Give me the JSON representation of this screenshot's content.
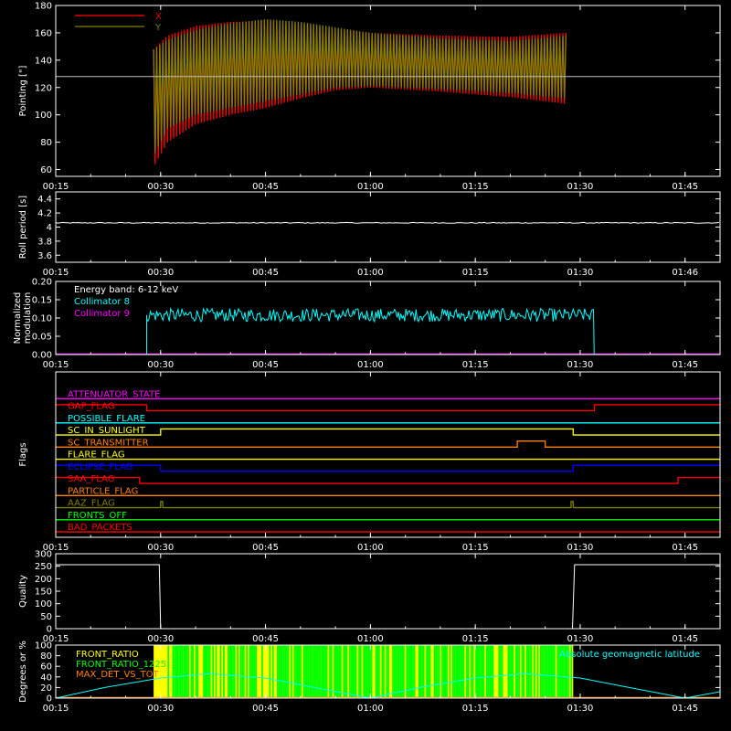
{
  "chart_data": [
    {
      "type": "line",
      "ylabel": "Pointing [\"]",
      "ylim": [
        55,
        180
      ],
      "yticks": [
        60,
        80,
        100,
        120,
        140,
        160,
        180
      ],
      "xticks": [
        "00:15",
        "00:30",
        "00:45",
        "01:00",
        "01:15",
        "01:30",
        "01:45"
      ],
      "xrange_min": [
        15,
        110
      ],
      "reference_line": 128,
      "legend": {
        "position": "top-left"
      },
      "series": [
        {
          "name": "X",
          "color": "#ff0000",
          "t": [
            29,
            31,
            35,
            40,
            45,
            50,
            55,
            60,
            70,
            80,
            88
          ],
          "min": [
            62,
            80,
            93,
            100,
            105,
            112,
            118,
            120,
            117,
            113,
            108
          ],
          "max": [
            148,
            158,
            165,
            168,
            169,
            166,
            163,
            160,
            158,
            157,
            160
          ]
        },
        {
          "name": "Y",
          "color": "#808000",
          "t": [
            29,
            31,
            35,
            40,
            45,
            50,
            55,
            60,
            70,
            80,
            88
          ],
          "min": [
            70,
            90,
            100,
            105,
            110,
            115,
            120,
            121,
            119,
            116,
            112
          ],
          "max": [
            148,
            155,
            162,
            167,
            170,
            168,
            164,
            160,
            156,
            154,
            158
          ]
        }
      ]
    },
    {
      "type": "line",
      "ylabel": "Roll period [s]",
      "ylim": [
        3.5,
        4.5
      ],
      "yticks": [
        3.6,
        3.8,
        4.0,
        4.2,
        4.4
      ],
      "xticks": [
        "00:15",
        "00:30",
        "00:45",
        "01:00",
        "01:15",
        "01:30",
        "01:46"
      ],
      "xrange_min": [
        15,
        110
      ],
      "series": [
        {
          "name": "",
          "color": "#ffffff",
          "t": [
            15,
            110
          ],
          "values": [
            4.06,
            4.06
          ]
        }
      ]
    },
    {
      "type": "line",
      "ylabel": "Normalized modulation",
      "ylim": [
        0,
        0.2
      ],
      "yticks": [
        0.0,
        0.05,
        0.1,
        0.15,
        0.2
      ],
      "yticklabels": [
        "0.00",
        "0.05",
        "0.10",
        "0.15",
        "0.20"
      ],
      "xticks": [
        "00:15",
        "00:30",
        "00:45",
        "01:00",
        "01:15",
        "01:30",
        "01:45"
      ],
      "xrange_min": [
        15,
        110
      ],
      "annotation": "Energy band: 6-12 keV",
      "legend": {
        "position": "top-left"
      },
      "series": [
        {
          "name": "Collimator 8",
          "color": "#00ffff",
          "t_start": 28,
          "t_end": 92,
          "mean": 0.108,
          "spread": 0.018
        },
        {
          "name": "Collimator 9",
          "color": "#ff00ff",
          "t": [
            15,
            110
          ],
          "values": [
            0,
            0
          ]
        }
      ]
    },
    {
      "type": "table",
      "ylabel": "Flags",
      "xticks": [
        "00:15",
        "00:30",
        "00:45",
        "01:00",
        "01:15",
        "01:30",
        "01:45"
      ],
      "xrange_min": [
        15,
        110
      ],
      "flags": [
        {
          "name": "ATTENUATOR_STATE",
          "color": "#ff00ff",
          "on": []
        },
        {
          "name": "GAP_FLAG",
          "color": "#ff0000",
          "on": [
            [
              15,
              28
            ],
            [
              92,
              110
            ]
          ]
        },
        {
          "name": "POSSIBLE_FLARE",
          "color": "#00ffff",
          "on": []
        },
        {
          "name": "SC_IN_SUNLIGHT",
          "color": "#ffff00",
          "on": [
            [
              30,
              89
            ]
          ]
        },
        {
          "name": "SC_TRANSMITTER",
          "color": "#ff8000",
          "on": [
            [
              81,
              85
            ]
          ]
        },
        {
          "name": "FLARE_FLAG",
          "color": "#ffff00",
          "on": []
        },
        {
          "name": "ECLIPSE_FLAG",
          "color": "#0000ff",
          "on": [
            [
              15,
              30
            ],
            [
              89,
              110
            ]
          ]
        },
        {
          "name": "SAA_FLAG",
          "color": "#ff0000",
          "on": [
            [
              15,
              27
            ],
            [
              104,
              110
            ]
          ]
        },
        {
          "name": "PARTICLE_FLAG",
          "color": "#ff8000",
          "on": []
        },
        {
          "name": "AAZ_FLAG",
          "color": "#808000",
          "on": [
            [
              30,
              30.3
            ],
            [
              88.7,
              89
            ]
          ]
        },
        {
          "name": "FRONTS_OFF",
          "color": "#00ff00",
          "on": []
        },
        {
          "name": "BAD_PACKETS",
          "color": "#ff0000",
          "on": []
        }
      ]
    },
    {
      "type": "line",
      "ylabel": "Quality",
      "ylim": [
        0,
        300
      ],
      "yticks": [
        0,
        50,
        100,
        150,
        200,
        250,
        300
      ],
      "xticks": [
        "00:15",
        "00:30",
        "00:45",
        "01:00",
        "01:15",
        "01:30",
        "01:45"
      ],
      "xrange_min": [
        15,
        110
      ],
      "series": [
        {
          "name": "",
          "color": "#ffffff",
          "t": [
            15,
            29.8,
            30.0,
            88.9,
            89.2,
            110
          ],
          "values": [
            256,
            256,
            0,
            0,
            256,
            256
          ]
        }
      ]
    },
    {
      "type": "area",
      "ylabel": "Degrees or %",
      "ylim": [
        0,
        100
      ],
      "yticks": [
        0,
        20,
        40,
        60,
        80,
        100
      ],
      "xticks": [
        "00:15",
        "00:30",
        "00:45",
        "01:00",
        "01:15",
        "01:30",
        "01:45"
      ],
      "xrange_min": [
        15,
        110
      ],
      "legend": {
        "position": "top-left"
      },
      "series": [
        {
          "name": "FRONT_RATIO",
          "color": "#ffff00",
          "t_start": 29,
          "t_end": 89,
          "value": 100
        },
        {
          "name": "FRONT_RATIO_1225",
          "color": "#00ff00",
          "t_start": 31,
          "t_end": 89,
          "value": 100
        },
        {
          "name": "MAX_DET_VS_TOT",
          "color": "#ff8000",
          "t": [
            15,
            110
          ],
          "values": [
            0,
            0
          ]
        },
        {
          "name": "Absolute geomagnetic latitude",
          "color": "#00ffff",
          "t": [
            15,
            22,
            30,
            37,
            45,
            52,
            60,
            67,
            75,
            82,
            90,
            97,
            105,
            110
          ],
          "values": [
            0,
            20,
            38,
            46,
            38,
            20,
            0,
            20,
            38,
            46,
            38,
            20,
            0,
            12
          ]
        }
      ]
    }
  ]
}
